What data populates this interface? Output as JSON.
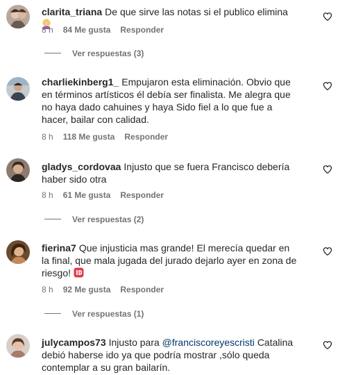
{
  "comments": [
    {
      "username": "clarita_triana",
      "text": "De que sirve las notas si el publico elimina",
      "emoji": "blonde-woman-facepalm-emoji",
      "time": "8 h",
      "likes": "84 Me gusta",
      "reply": "Responder",
      "view_replies": "Ver respuestas (3)"
    },
    {
      "username": "charliekinberg1_",
      "text": "Empujaron esta eliminación. Obvio que en términos artísticos él debía ser finalista. Me alegra que no haya dado cahuines y haya Sido fiel a lo que fue a hacer, bailar con calidad.",
      "time": "8 h",
      "likes": "118 Me gusta",
      "reply": "Responder"
    },
    {
      "username": "gladys_cordovaa",
      "text": "Injusto que se fuera Francisco debería haber sido otra",
      "time": "8 h",
      "likes": "61 Me gusta",
      "reply": "Responder",
      "view_replies": "Ver respuestas (2)"
    },
    {
      "username": "fierina7",
      "text": "Que injusticia mas grande! El merecía quedar en la final, que mala jugada del jurado dejarlo ayer en zona de riesgo!",
      "emoji": "id-button-emoji",
      "time": "8 h",
      "likes": "92 Me gusta",
      "reply": "Responder",
      "view_replies": "Ver respuestas (1)"
    },
    {
      "username": "julycampos73",
      "text_before": "Injusto para",
      "mention": "@franciscoreyescristi",
      "text_after": "Catalina debió haberse ido ya que podría mostrar ,sólo queda contemplar a su gran bailarín."
    }
  ],
  "colors": {
    "text": "#262626",
    "secondary": "#737373",
    "mention": "#00376b",
    "emoji_red": "#e23b4e"
  }
}
